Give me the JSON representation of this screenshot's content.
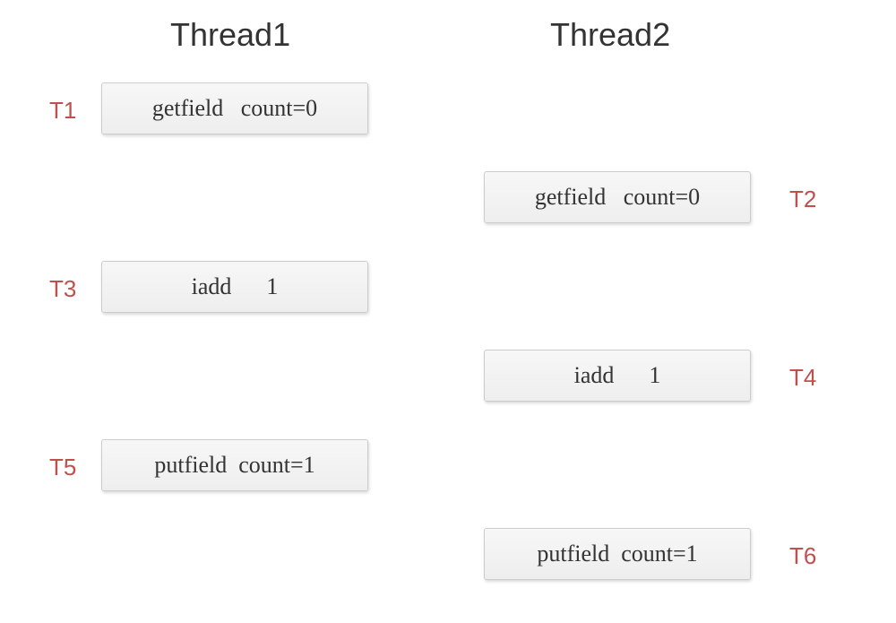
{
  "headers": {
    "thread1": "Thread1",
    "thread2": "Thread2"
  },
  "steps": {
    "t1": {
      "label": "T1",
      "instruction": "getfield   count=0"
    },
    "t2": {
      "label": "T2",
      "instruction": "getfield   count=0"
    },
    "t3": {
      "label": "T3",
      "instruction": "iadd      1"
    },
    "t4": {
      "label": "T4",
      "instruction": "iadd      1"
    },
    "t5": {
      "label": "T5",
      "instruction": "putfield  count=1"
    },
    "t6": {
      "label": "T6",
      "instruction": "putfield  count=1"
    }
  }
}
